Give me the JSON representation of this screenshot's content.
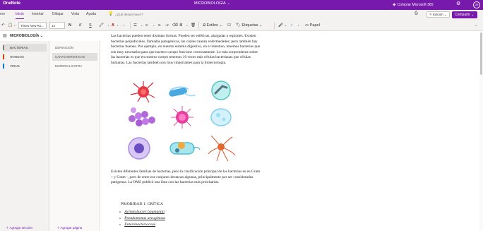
{
  "app": {
    "name": "OneNote",
    "notebook": "MICROBIOLOGÍA",
    "buy_label": "Comprar Microsoft 365",
    "avatar": "JR"
  },
  "tabs": [
    {
      "label": "rvo",
      "active": false
    },
    {
      "label": "Inicio",
      "active": true
    },
    {
      "label": "Insertar",
      "active": false
    },
    {
      "label": "Dibujar",
      "active": false
    },
    {
      "label": "Vista",
      "active": false
    },
    {
      "label": "Ayuda",
      "active": false
    }
  ],
  "tell_me": "¿Qué desea hacer?",
  "edit_label": "Edición",
  "share_label": "Compartir",
  "ribbon": {
    "font_name": "Times New Ro...",
    "font_size": "14",
    "bold": "N",
    "italic": "K",
    "underline": "S",
    "styles": "Estilos",
    "tags": "Etiquetas",
    "paper": "Papel"
  },
  "sidebar": {
    "notebook_label": "MICROBIOLOGÍA",
    "sections": [
      {
        "label": "BACTERIAS",
        "color": "#7f7f7f",
        "active": true
      },
      {
        "label": "HONGOS",
        "color": "#d83b01",
        "active": false
      },
      {
        "label": "VIRUS",
        "color": "#0078d4",
        "active": false
      }
    ],
    "pages": [
      {
        "label": "DEFINICIÓN",
        "active": false
      },
      {
        "label": "CARACTERÍSTICAS",
        "active": true
      },
      {
        "label": "MATERIAL EXTRA",
        "active": false
      }
    ],
    "add_section": "Agregar sección",
    "add_page": "Agregar página"
  },
  "content": {
    "paragraph1": "Las bacterias pueden tener distintas formas. Pueden ser esféricas, alargadas o espirales. Existen bacterias perjudiciales, llamadas patogénicas, las cuales causan enfermedades; pero también hay bacterias buenas. Por ejemplo, en nuestro sistema digestivo, en el intestino, tenemos bacterias que son muy necesarias para que nuestro cuerpo funcione correctamente. Lo más sorprendente sobre las bacterias es que en nuestro cuerpo tenemos 10 veces más células bacterianas que células humanas. Las bacterias también son muy importantes para la biotecnología.",
    "paragraph2": "Existen diferentes familias de bacterias, pero la clasificación principal de las bacterias es en Gram + y Gram -, pero de entre ese conjunto destacan algunas, principalmente por ser consideradas patógenas. La OMS publicó una lista con las bacterias más prioritarias.",
    "priority_title": "PRIORIDAD 1: CRÍTICA",
    "priority_items": [
      "Acinetobacter baumannii",
      "Pseudomonas aeruginosa",
      "Enterobacteriaceae"
    ]
  },
  "colors": {
    "accent": "#7719aa"
  }
}
